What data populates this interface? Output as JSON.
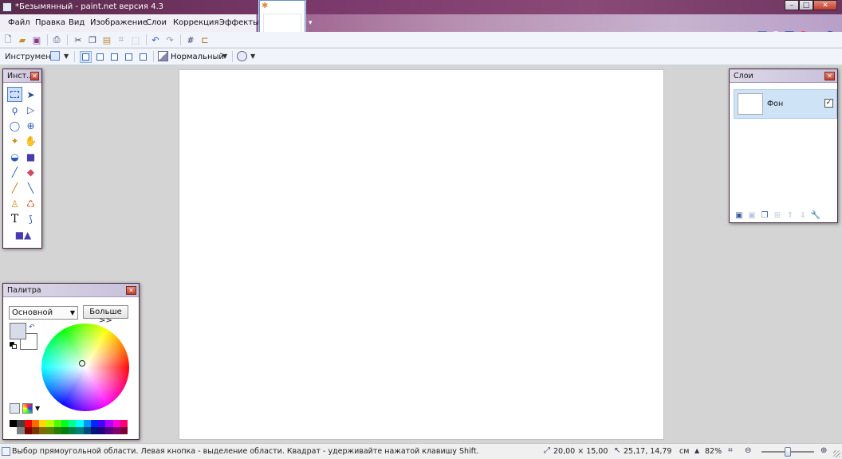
{
  "window": {
    "title": "*Безымянный - paint.net версия 4.3",
    "controls": {
      "minimize": "–",
      "maximize": "□",
      "close": "✕"
    }
  },
  "menu": {
    "items": [
      "Файл",
      "Правка",
      "Вид",
      "Изображение",
      "Слои",
      "Коррекция",
      "Эффекты"
    ]
  },
  "utility_icons": [
    "tools-window-icon",
    "history-window-icon",
    "layers-window-icon",
    "colors-window-icon",
    "settings-icon",
    "help-icon"
  ],
  "toolbar": {
    "instrument_label": "Инструмент:",
    "blend_mode": "Нормальный"
  },
  "panels": {
    "tools": {
      "title": "Инст..."
    },
    "palette": {
      "title": "Палитра",
      "mode": "Основной",
      "more_label": "Больше >>",
      "primary_color": "#d6dcea",
      "secondary_color": "#ffffff"
    },
    "layers": {
      "title": "Слои",
      "layer": {
        "name": "Фон",
        "visible": true
      }
    }
  },
  "palette_colors": [
    "#000000",
    "#404040",
    "#ff0000",
    "#ff6a00",
    "#ffd800",
    "#b6ff00",
    "#4cff00",
    "#00ff21",
    "#00ff90",
    "#00ffff",
    "#0094ff",
    "#0026ff",
    "#4800ff",
    "#b200ff",
    "#ff00dc",
    "#ff006e",
    "#ffffff",
    "#808080",
    "#7f0000",
    "#7f3300",
    "#7f6a00",
    "#5b7f00",
    "#267f00",
    "#007f0e",
    "#007f46",
    "#007f7f",
    "#004a7f",
    "#00137f",
    "#21007f",
    "#57007f",
    "#7f006e",
    "#7f0037"
  ],
  "status": {
    "message": "Выбор прямоугольной области. Левая кнопка - выделение области. Квадрат - удерживайте нажатой клавишу Shift.",
    "image_size": "20,00 × 15,00",
    "cursor_pos": "25,17, 14,79",
    "units": "см",
    "zoom": "82%"
  }
}
